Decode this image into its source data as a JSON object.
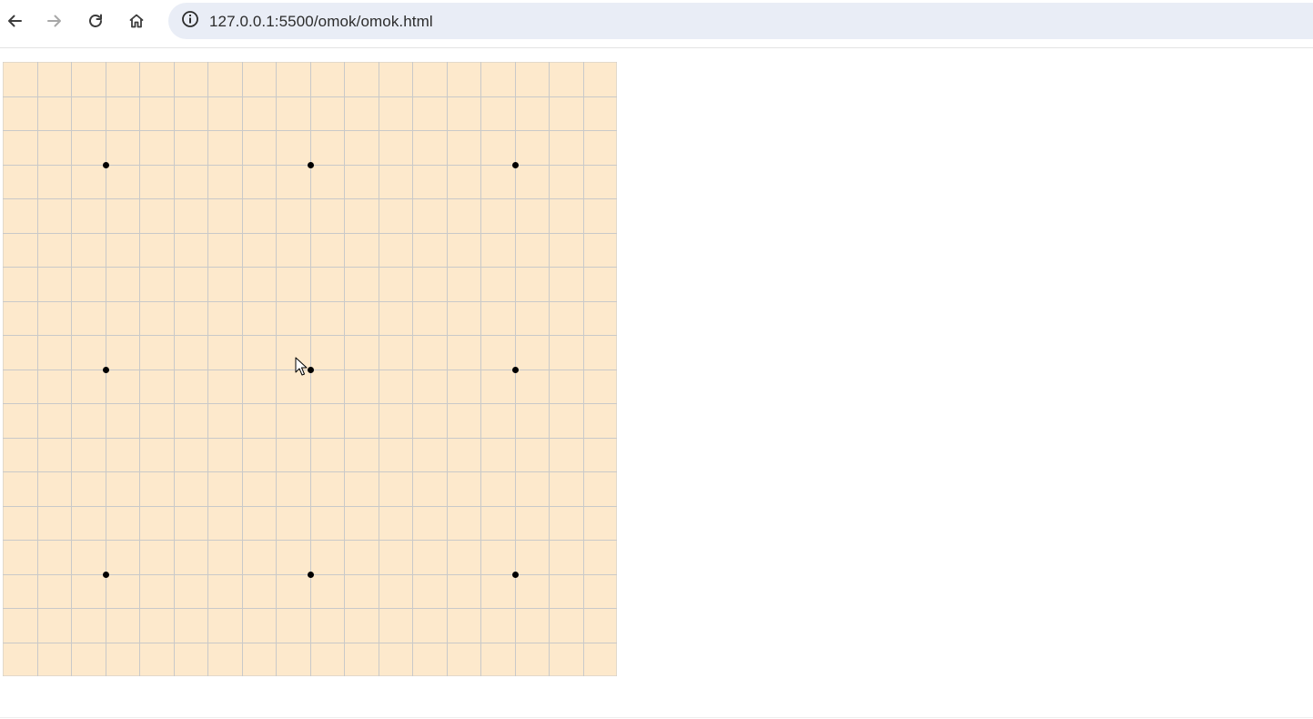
{
  "browser": {
    "url": "127.0.0.1:5500/omok/omok.html",
    "back_icon": "arrow-left-icon",
    "forward_icon": "arrow-right-icon",
    "reload_icon": "reload-icon",
    "home_icon": "home-icon",
    "site_info_icon": "info-circle-icon"
  },
  "board": {
    "rows": 18,
    "cols": 18,
    "background_color": "#fde9cc",
    "grid_line_color": "#c9c9c9",
    "star_point_color": "#000000",
    "star_points": [
      {
        "col": 3,
        "row": 3
      },
      {
        "col": 9,
        "row": 3
      },
      {
        "col": 15,
        "row": 3
      },
      {
        "col": 3,
        "row": 9
      },
      {
        "col": 9,
        "row": 9
      },
      {
        "col": 15,
        "row": 9
      },
      {
        "col": 3,
        "row": 15
      },
      {
        "col": 9,
        "row": 15
      },
      {
        "col": 15,
        "row": 15
      }
    ]
  }
}
